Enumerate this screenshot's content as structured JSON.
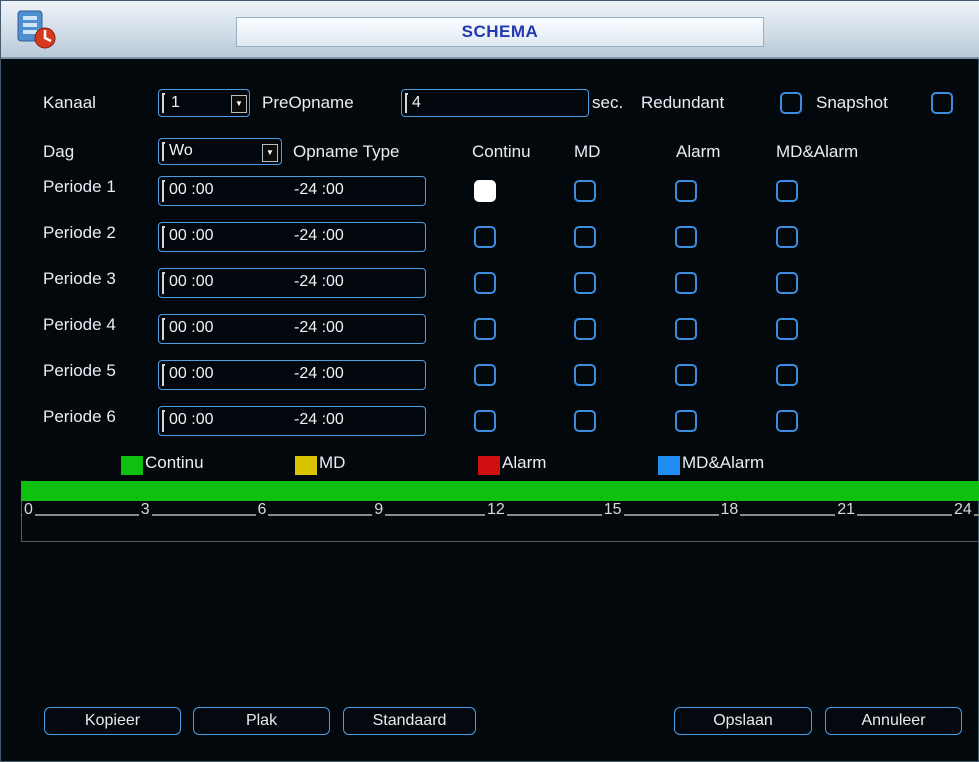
{
  "title": "SCHEMA",
  "icons": {
    "app": "dvr-app-icon",
    "dropdown": "dropdown-arrow-icon"
  },
  "top": {
    "channel_label": "Kanaal",
    "channel_value": "1",
    "prerecord_label": "PreOpname",
    "prerecord_value": "4",
    "sec_label": "sec.",
    "redundant_label": "Redundant",
    "redundant_checked": false,
    "snapshot_label": "Snapshot",
    "snapshot_checked": false
  },
  "day": {
    "label": "Dag",
    "value": "Wo"
  },
  "columns": {
    "record_type": "Opname Type",
    "continu": "Continu",
    "md": "MD",
    "alarm": "Alarm",
    "md_alarm": "MD&Alarm"
  },
  "periods": [
    {
      "label": "Periode 1",
      "start": "00 :00",
      "end": "-24 :00",
      "continu": true,
      "md": false,
      "alarm": false,
      "md_alarm": false
    },
    {
      "label": "Periode 2",
      "start": "00 :00",
      "end": "-24 :00",
      "continu": false,
      "md": false,
      "alarm": false,
      "md_alarm": false
    },
    {
      "label": "Periode 3",
      "start": "00 :00",
      "end": "-24 :00",
      "continu": false,
      "md": false,
      "alarm": false,
      "md_alarm": false
    },
    {
      "label": "Periode 4",
      "start": "00 :00",
      "end": "-24 :00",
      "continu": false,
      "md": false,
      "alarm": false,
      "md_alarm": false
    },
    {
      "label": "Periode 5",
      "start": "00 :00",
      "end": "-24 :00",
      "continu": false,
      "md": false,
      "alarm": false,
      "md_alarm": false
    },
    {
      "label": "Periode 6",
      "start": "00 :00",
      "end": "-24 :00",
      "continu": false,
      "md": false,
      "alarm": false,
      "md_alarm": false
    }
  ],
  "legend": [
    {
      "label": "Continu",
      "color": "#10c010"
    },
    {
      "label": "MD",
      "color": "#d8c400"
    },
    {
      "label": "Alarm",
      "color": "#d01010"
    },
    {
      "label": "MD&Alarm",
      "color": "#1e8cf0"
    }
  ],
  "timeline": {
    "fill_color": "#10c010",
    "range_start_hour": 0,
    "range_end_hour": 24,
    "tick_labels": [
      "0",
      "3",
      "6",
      "9",
      "12",
      "15",
      "18",
      "21",
      "24"
    ]
  },
  "buttons": {
    "copy": "Kopieer",
    "paste": "Plak",
    "default": "Standaard",
    "save": "Opslaan",
    "cancel": "Annuleer"
  }
}
